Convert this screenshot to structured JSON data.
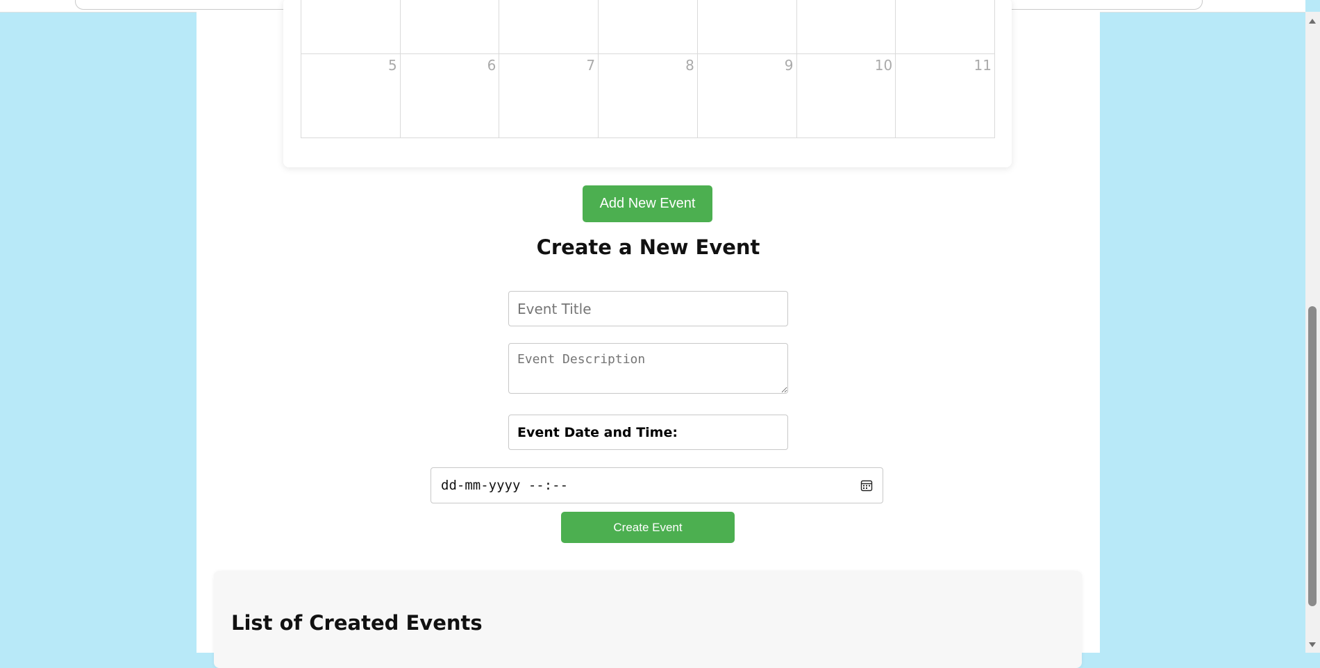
{
  "calendar": {
    "top_row_days": [
      "",
      "",
      "",
      "",
      "",
      "",
      ""
    ],
    "week_days": [
      "5",
      "6",
      "7",
      "8",
      "9",
      "10",
      "11"
    ]
  },
  "actions": {
    "add_new_event_label": "Add New Event",
    "create_event_label": "Create Event"
  },
  "create_form": {
    "heading": "Create a New Event",
    "title_placeholder": "Event Title",
    "description_placeholder": "Event Description",
    "datetime_label": "Event Date and Time:",
    "datetime_value": "dd-mm-yyyy --:--"
  },
  "events_list": {
    "heading": "List of Created Events"
  },
  "colors": {
    "accent": "#4caf50",
    "background": "#b8e9f8"
  },
  "icons": [
    "calendar-icon",
    "scroll-up-icon",
    "scroll-down-icon"
  ]
}
